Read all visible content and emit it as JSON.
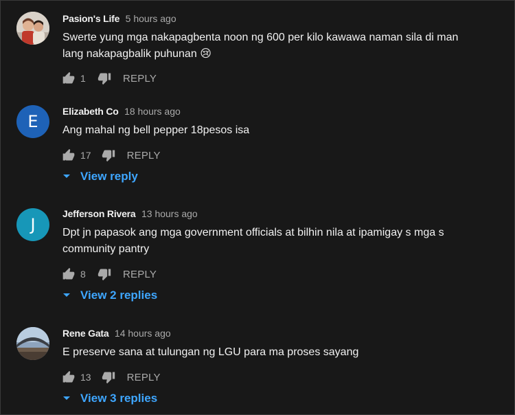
{
  "comments": [
    {
      "author": "Pasion's Life",
      "time": "5 hours ago",
      "text": "Swerte yung mga nakapagbenta noon ng 600 per kilo kawawa naman sila di man lang nakapagbalik puhunan",
      "emoji": "😢",
      "likes": "1",
      "reply_label": "REPLY",
      "avatar": "photo"
    },
    {
      "author": "Elizabeth Co",
      "time": "18 hours ago",
      "text": "Ang mahal ng bell pepper 18pesos isa",
      "likes": "17",
      "reply_label": "REPLY",
      "avatar_letter": "E",
      "view_replies": "View reply"
    },
    {
      "author": "Jefferson Rivera",
      "time": "13 hours ago",
      "text": "Dpt jn papasok ang mga government officials at bilhin nila at ipamigay s mga s community pantry",
      "likes": "8",
      "reply_label": "REPLY",
      "avatar_letter": "J",
      "view_replies": "View 2 replies"
    },
    {
      "author": "Rene Gata",
      "time": "14 hours ago",
      "text": "E preserve sana at tulungan ng LGU para ma proses  sayang",
      "likes": "13",
      "reply_label": "REPLY",
      "avatar": "photo",
      "view_replies": "View 3 replies"
    }
  ],
  "colors": {
    "background": "#181818",
    "text": "#f1f1f1",
    "secondary": "#aaaaaa",
    "link": "#3ea6ff"
  }
}
